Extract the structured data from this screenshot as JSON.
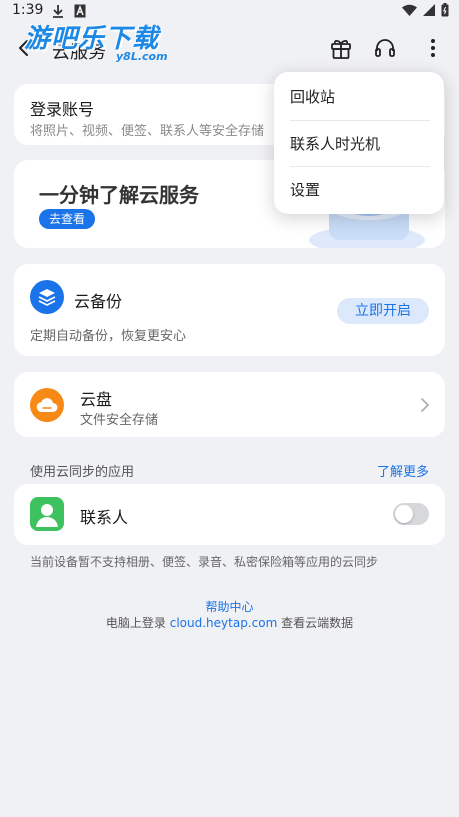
{
  "status_bar": {
    "time": "1:39",
    "icons": [
      "download-icon",
      "text-a-icon",
      "wifi-icon",
      "signal-icon",
      "battery-icon"
    ]
  },
  "watermark": {
    "text": "游吧乐下载",
    "sub": "y8L.com"
  },
  "header": {
    "title": "云服务",
    "icons": [
      "back-icon",
      "gift-icon",
      "headset-icon",
      "more-vertical-icon"
    ]
  },
  "login_card": {
    "title": "登录账号",
    "subtitle": "将照片、视频、便签、联系人等安全存储"
  },
  "promo_card": {
    "title": "一分钟了解云服务",
    "button": "去查看"
  },
  "backup_card": {
    "title": "云备份",
    "subtitle": "定期自动备份，恢复更安心",
    "button": "立即开启"
  },
  "disk_card": {
    "title": "云盘",
    "subtitle": "文件安全存储"
  },
  "sync_section": {
    "label": "使用云同步的应用",
    "link": "了解更多"
  },
  "contacts_card": {
    "title": "联系人",
    "toggle_on": false
  },
  "footnote": "当前设备暂不支持相册、便签、录音、私密保险箱等应用的云同步",
  "help": {
    "link": "帮助中心",
    "line_prefix": "电脑上登录 ",
    "domain": "cloud.heytap.com",
    "line_suffix": " 查看云端数据"
  },
  "dropdown_menu": {
    "items": [
      "回收站",
      "联系人时光机",
      "设置"
    ]
  },
  "colors": {
    "accent": "#1a73e8",
    "disk_orange": "#f78a16",
    "contacts_green": "#3ec15f",
    "background": "#f0f1f4"
  }
}
